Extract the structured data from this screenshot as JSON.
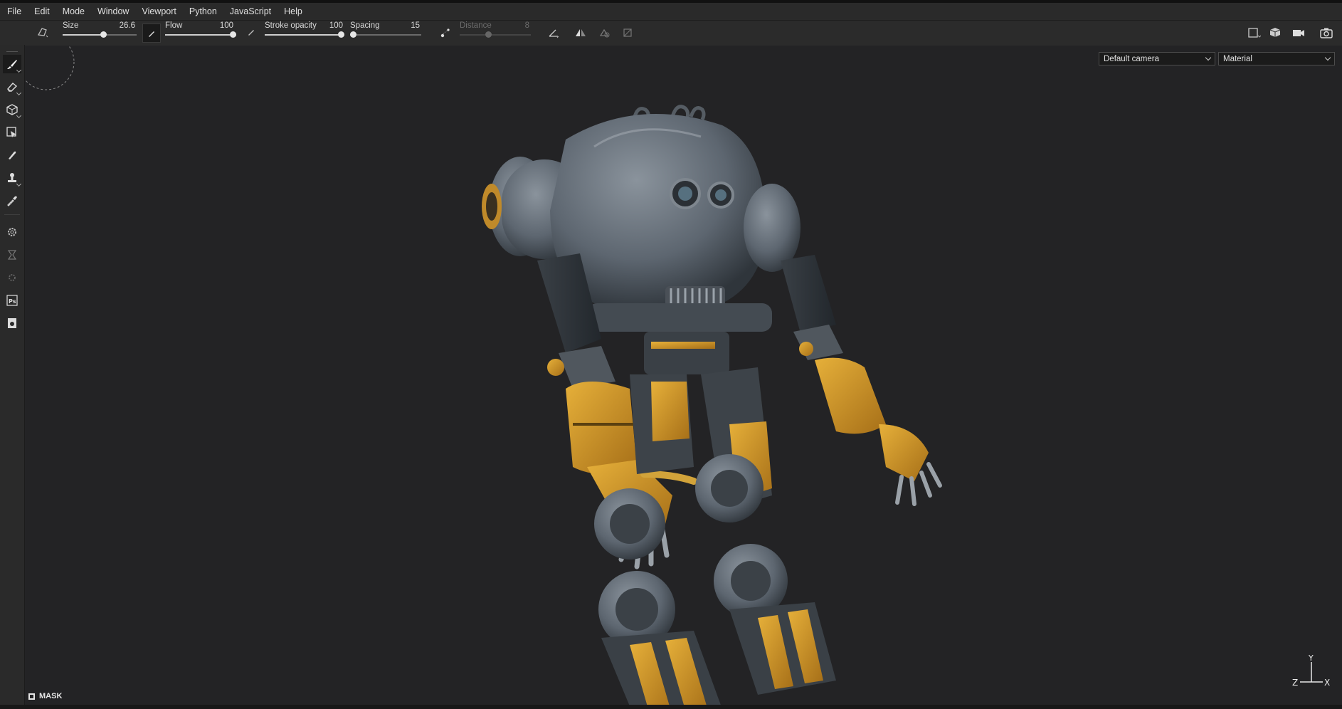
{
  "menu": [
    "File",
    "Edit",
    "Mode",
    "Window",
    "Viewport",
    "Python",
    "JavaScript",
    "Help"
  ],
  "toolbar": {
    "size_label": "Size",
    "size_value": "26.6",
    "size_fill": 0.55,
    "flow_label": "Flow",
    "flow_value": "100",
    "flow_fill": 1.0,
    "stroke_opacity_label": "Stroke opacity",
    "stroke_opacity_value": "100",
    "stroke_opacity_fill": 1.0,
    "spacing_label": "Spacing",
    "spacing_value": "15",
    "spacing_fill": 0.04,
    "distance_label": "Distance",
    "distance_value": "8",
    "distance_fill": 0.4
  },
  "left_tools": [
    "paint-brush-icon",
    "eraser-icon",
    "projection-icon",
    "polygon-fill-icon",
    "smudge-icon",
    "clone-icon",
    "color-picker-icon",
    "settings-icon",
    "bake-icon",
    "physics-icon",
    "photoshop-icon",
    "screenshot-icon"
  ],
  "viewport": {
    "camera_select": "Default camera",
    "material_select": "Material",
    "mask_label": "MASK",
    "gizmo": {
      "y": "Y",
      "x": "X",
      "z": "Z"
    }
  },
  "colors": {
    "accent_yellow": "#d8a22a",
    "steel": "#6b7580",
    "background": "#232325"
  }
}
